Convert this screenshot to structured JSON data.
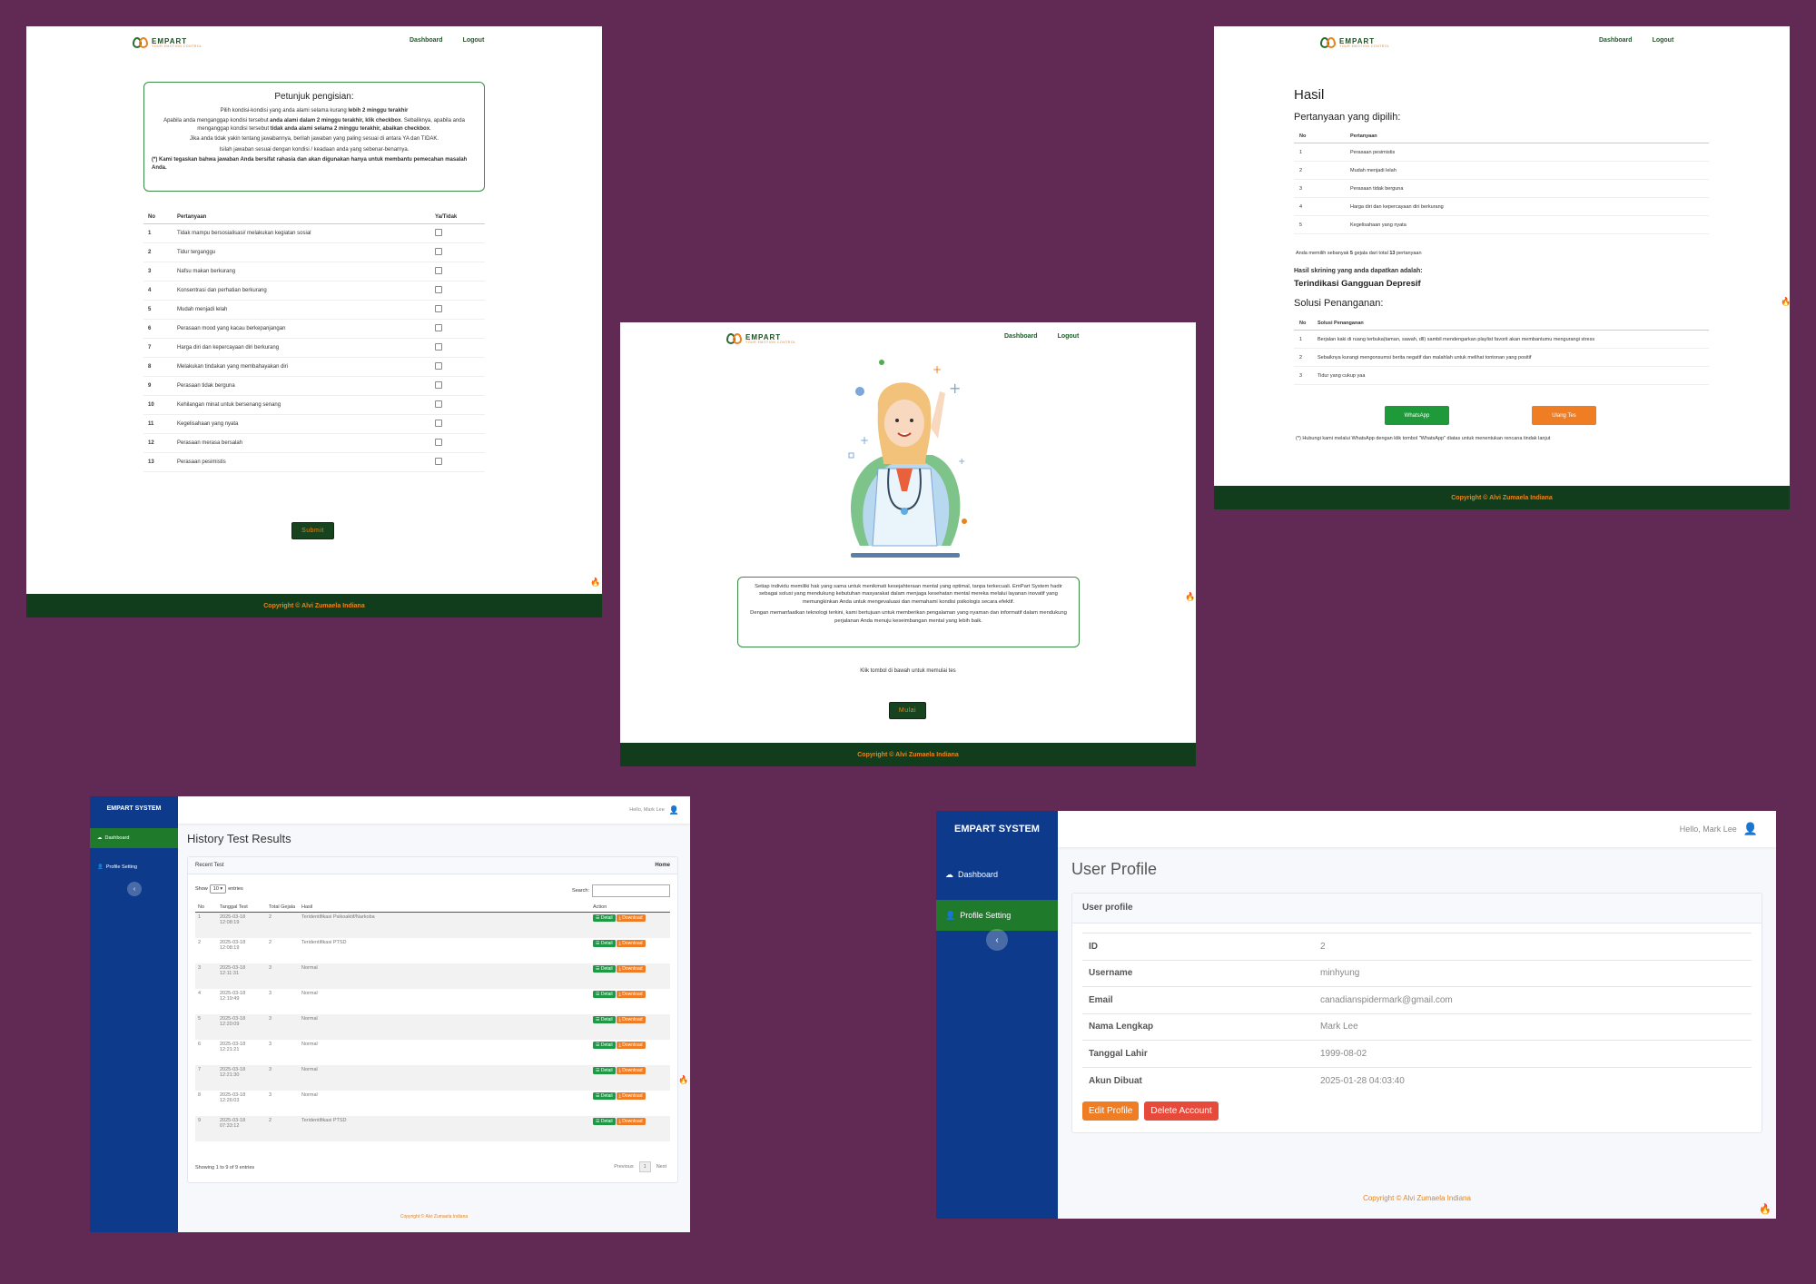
{
  "brand": {
    "name": "EMPART",
    "tagline": "YOUR EMOTION CONTROL"
  },
  "nav": {
    "dashboard": "Dashboard",
    "logout": "Logout"
  },
  "colors": {
    "background": "#612a55",
    "dark_green": "#123d1c",
    "accent_orange": "#e8841c",
    "sidebar_blue": "#0d3a8a",
    "active_green": "#207a2c"
  },
  "questionnaire": {
    "instructions": {
      "title": "Petunjuk pengisian:",
      "line1_prefix": "Pilih kondisi-kondisi yang anda alami selama kurang ",
      "line1_bold": "lebih 2 minggu terakhir",
      "line2_a": "Apabila anda menganggap kondisi tersebut ",
      "line2_b": "anda alami dalam 2 minggu terakhir, klik checkbox",
      "line2_c": ". Sebaliknya, apabila anda menganggap kondisi tersebut ",
      "line2_d": "tidak anda alami selama 2 minggu terakhir, abaikan checkbox",
      "line3": "Jika anda tidak yakin tentang jawabannya, berilah jawaban yang paling sesuai di antara YA dan TIDAK.",
      "line4": "Isilah jawaban sesuai dengan kondisi / keadaan anda yang sebenar-benarnya.",
      "note": "(*) Kami tegaskan bahwa jawaban Anda bersifat rahasia dan akan digunakan hanya untuk membantu pemecahan masalah Anda."
    },
    "headers": {
      "no": "No",
      "question": "Pertanyaan",
      "answer": "Ya/Tidak"
    },
    "questions": [
      {
        "no": "1",
        "text": "Tidak mampu bersosialisasi/ melakukan kegiatan sosial"
      },
      {
        "no": "2",
        "text": "Tidur terganggu"
      },
      {
        "no": "3",
        "text": "Nafsu makan berkurang"
      },
      {
        "no": "4",
        "text": "Konsentrasi dan perhatian berkurang"
      },
      {
        "no": "5",
        "text": "Mudah menjadi lelah"
      },
      {
        "no": "6",
        "text": "Perasaan mood yang kacau berkepanjangan"
      },
      {
        "no": "7",
        "text": "Harga diri dan kepercayaan diri berkurang"
      },
      {
        "no": "8",
        "text": "Melakukan tindakan yang membahayakan diri"
      },
      {
        "no": "9",
        "text": "Perasaan tidak berguna"
      },
      {
        "no": "10",
        "text": "Kehilangan minat untuk bersenang senang"
      },
      {
        "no": "11",
        "text": "Kegelisahaan yang nyata"
      },
      {
        "no": "12",
        "text": "Perasaan merasa bersalah"
      },
      {
        "no": "13",
        "text": "Perasaan pesimistis"
      }
    ],
    "submit": "Submit"
  },
  "footer": {
    "copyright": "Copyright © Alvi Zumaela Indiana"
  },
  "landing": {
    "p1": "Setiap individu memiliki hak yang sama untuk menikmati kesejahteraan mental yang optimal, tanpa terkecuali. EmPart System hadir sebagai solusi yang mendukung kebutuhan masyarakat dalam menjaga kesehatan mental mereka melalui layanan inovatif yang memungkinkan Anda untuk mengevaluasi dan memahami kondisi psikologis secara efektif.",
    "p2": "Dengan memanfaatkan teknologi terkini, kami bertujuan untuk memberikan pengalaman yang nyaman dan informatif dalam mendukung perjalanan Anda menuju keseimbangan mental yang lebih baik.",
    "prompt": "Klik tombol di bawah untuk memulai tes",
    "start": "Mulai"
  },
  "result": {
    "title": "Hasil",
    "selected_title": "Pertanyaan yang dipilih:",
    "headers": {
      "no": "No",
      "question": "Pertanyaan"
    },
    "selected": [
      {
        "no": "1",
        "text": "Perasaan pesimistis"
      },
      {
        "no": "2",
        "text": "Mudah menjadi lelah"
      },
      {
        "no": "3",
        "text": "Perasaan tidak berguna"
      },
      {
        "no": "4",
        "text": "Harga diri dan kepercayaan diri berkurang"
      },
      {
        "no": "5",
        "text": "Kegelisahaan yang nyata"
      }
    ],
    "summary_a": "Anda memilih sebanyak ",
    "summary_count": "5",
    "summary_b": " gejala dari total ",
    "summary_total": "13",
    "summary_c": " pertanyaan",
    "screening_label": "Hasil skrining yang anda dapatkan adalah:",
    "diagnosis": "Terindikasi Gangguan Depresif",
    "solution_title": "Solusi Penanganan:",
    "solution_header": "Solusi Penanganan",
    "solutions": [
      {
        "no": "1",
        "text": "Berjalan kaki di ruang terbuka(taman, sawah, dll) sambil mendengarkan playlist favorit akan membantumu mengurangi stress"
      },
      {
        "no": "2",
        "text": "Sebaiknya kurangi mengonsumsi berita negatif dan malahlah untuk melihat tontonan yang positif"
      },
      {
        "no": "3",
        "text": "Tidur yang cukup yaa"
      }
    ],
    "whatsapp": "WhatsApp",
    "retest": "Ulang Tes",
    "note": "(*) Hubungi kami melalui WhatsApp dengan klik tombol \"WhatsApp\" diatas untuk menentukan rencana tindak lanjut"
  },
  "dashboard": {
    "system": "EMPART SYSTEM",
    "menu": [
      "Dashboard",
      "Profile Setting"
    ],
    "greeting": "Hello, Mark Lee",
    "history_title": "History Test Results",
    "card_title": "Recent Test",
    "home": "Home",
    "show": "Show",
    "entries_value": "10",
    "entries": "entries",
    "search": "Search:",
    "columns": [
      "No",
      "Tanggal Test",
      "Total Gejala",
      "Hasil",
      "Action"
    ],
    "rows": [
      {
        "no": "1",
        "date": "2025-03-18 12:08:19",
        "total": "2",
        "result": "Teridentifikasi Psikoaktif/Narkoba"
      },
      {
        "no": "2",
        "date": "2025-03-18 12:08:19",
        "total": "2",
        "result": "Teridentifikasi PTSD"
      },
      {
        "no": "3",
        "date": "2025-03-18 12:11:31",
        "total": "3",
        "result": "Normal"
      },
      {
        "no": "4",
        "date": "2025-03-18 12:19:49",
        "total": "3",
        "result": "Normal"
      },
      {
        "no": "5",
        "date": "2025-03-18 12:20:09",
        "total": "3",
        "result": "Normal"
      },
      {
        "no": "6",
        "date": "2025-03-18 12:21:21",
        "total": "3",
        "result": "Normal"
      },
      {
        "no": "7",
        "date": "2025-03-18 12:21:30",
        "total": "3",
        "result": "Normal"
      },
      {
        "no": "8",
        "date": "2025-03-18 12:26:03",
        "total": "3",
        "result": "Normal"
      },
      {
        "no": "9",
        "date": "2025-03-18 07:33:12",
        "total": "2",
        "result": "Teridentifikasi PTSD"
      }
    ],
    "detail": "Detail",
    "download": "Download",
    "showing": "Showing 1 to 9 of 9 entries",
    "previous": "Previous",
    "page": "1",
    "next": "Next"
  },
  "profile": {
    "title": "User Profile",
    "card_title": "User profile",
    "fields": [
      {
        "label": "ID",
        "value": "2"
      },
      {
        "label": "Username",
        "value": "minhyung"
      },
      {
        "label": "Email",
        "value": "canadianspidermark@gmail.com"
      },
      {
        "label": "Nama Lengkap",
        "value": "Mark Lee"
      },
      {
        "label": "Tanggal Lahir",
        "value": "1999-08-02"
      },
      {
        "label": "Akun Dibuat",
        "value": "2025-01-28 04:03:40"
      }
    ],
    "edit": "Edit Profile",
    "delete": "Delete Account"
  }
}
